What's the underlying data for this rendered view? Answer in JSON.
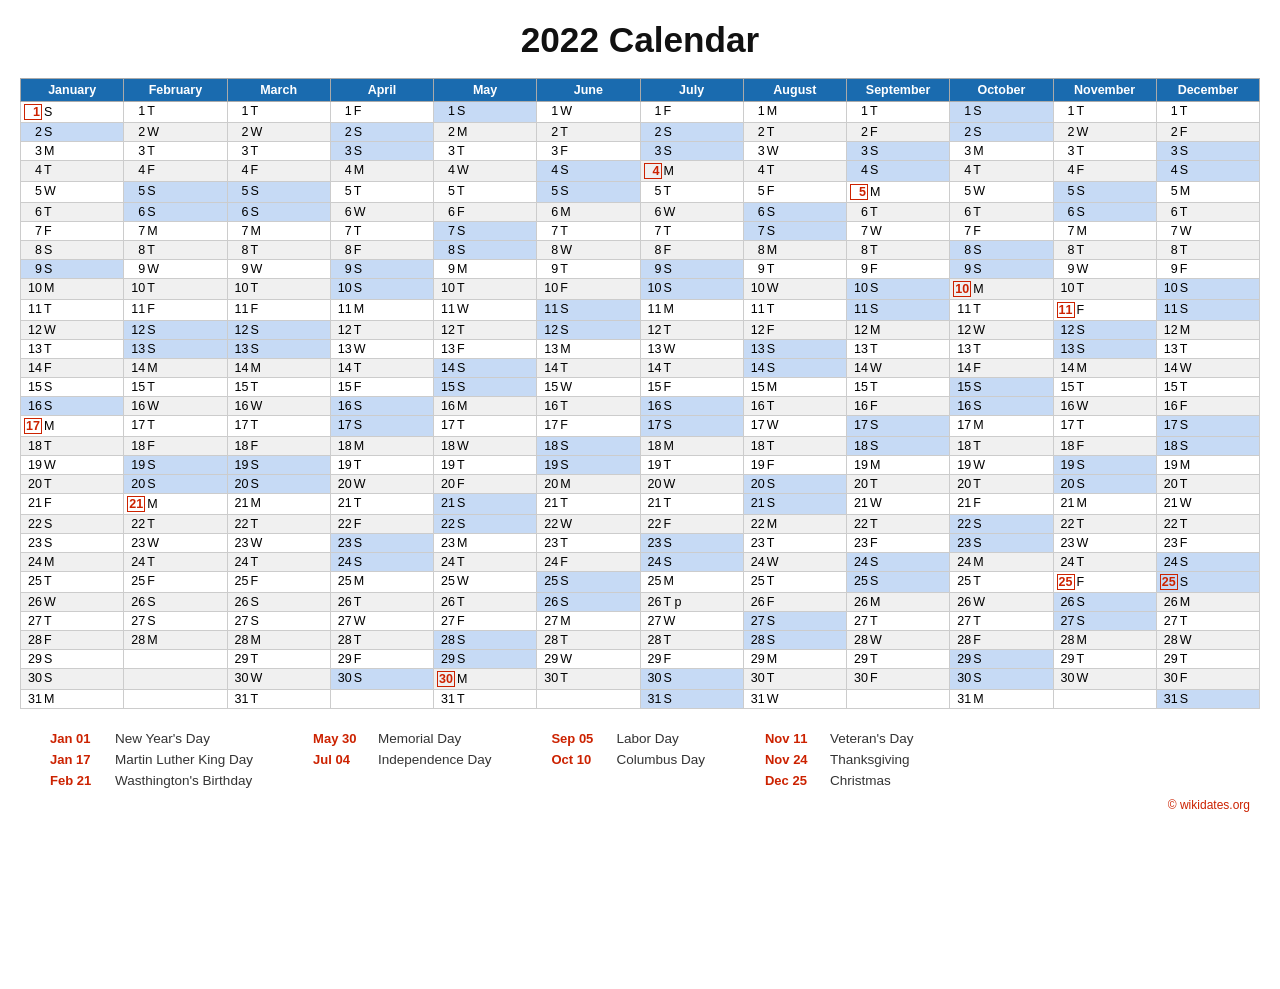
{
  "title": "2022 Calendar",
  "months": [
    "January",
    "February",
    "March",
    "April",
    "May",
    "June",
    "July",
    "August",
    "September",
    "October",
    "November",
    "December"
  ],
  "calendar": {
    "January": [
      "1 S",
      "2 S",
      "3 M",
      "4 T",
      "5 W",
      "6 T",
      "7 F",
      "8 S",
      "9 S",
      "10 M",
      "11 T",
      "12 W",
      "13 T",
      "14 F",
      "15 S",
      "16 S",
      "17 M",
      "18 T",
      "19 W",
      "20 T",
      "21 F",
      "22 S",
      "23 S",
      "24 M",
      "25 T",
      "26 W",
      "27 T",
      "28 F",
      "29 S",
      "30 S",
      "31 M"
    ],
    "February": [
      "1 T",
      "2 W",
      "3 T",
      "4 F",
      "5 S",
      "6 S",
      "7 M",
      "8 T",
      "9 W",
      "10 T",
      "11 F",
      "12 S",
      "13 S",
      "14 M",
      "15 T",
      "16 W",
      "17 T",
      "18 F",
      "19 S",
      "20 S",
      "21 M",
      "22 T",
      "23 W",
      "24 T",
      "25 F",
      "26 S",
      "27 S",
      "28 M",
      "",
      "",
      ""
    ],
    "March": [
      "1 T",
      "2 W",
      "3 T",
      "4 F",
      "5 S",
      "6 S",
      "7 M",
      "8 T",
      "9 W",
      "10 T",
      "11 F",
      "12 S",
      "13 S",
      "14 M",
      "15 T",
      "16 W",
      "17 T",
      "18 F",
      "19 S",
      "20 S",
      "21 M",
      "22 T",
      "23 W",
      "24 T",
      "25 F",
      "26 S",
      "27 S",
      "28 M",
      "29 T",
      "30 W",
      "31 T"
    ],
    "April": [
      "1 F",
      "2 S",
      "3 S",
      "4 M",
      "5 T",
      "6 W",
      "7 T",
      "8 F",
      "9 S",
      "10 S",
      "11 M",
      "12 T",
      "13 W",
      "14 T",
      "15 F",
      "16 S",
      "17 S",
      "18 M",
      "19 T",
      "20 W",
      "21 T",
      "22 F",
      "23 S",
      "24 S",
      "25 M",
      "26 T",
      "27 W",
      "28 T",
      "29 F",
      "30 S",
      ""
    ],
    "May": [
      "1 S",
      "2 M",
      "3 T",
      "4 W",
      "5 T",
      "6 F",
      "7 S",
      "8 S",
      "9 M",
      "10 T",
      "11 W",
      "12 T",
      "13 F",
      "14 S",
      "15 S",
      "16 M",
      "17 T",
      "18 W",
      "19 T",
      "20 F",
      "21 S",
      "22 S",
      "23 M",
      "24 T",
      "25 W",
      "26 T",
      "27 F",
      "28 S",
      "29 S",
      "30 M",
      "31 T"
    ],
    "June": [
      "1 W",
      "2 T",
      "3 F",
      "4 S",
      "5 S",
      "6 M",
      "7 T",
      "8 W",
      "9 T",
      "10 F",
      "11 S",
      "12 S",
      "13 M",
      "14 T",
      "15 W",
      "16 T",
      "17 F",
      "18 S",
      "19 S",
      "20 M",
      "21 T",
      "22 W",
      "23 T",
      "24 F",
      "25 S",
      "26 S",
      "27 M",
      "28 T",
      "29 W",
      "30 T",
      ""
    ],
    "July": [
      "1 F",
      "2 S",
      "3 S",
      "4 M",
      "5 T",
      "6 W",
      "7 T",
      "8 F",
      "9 S",
      "10 S",
      "11 M",
      "12 T",
      "13 W",
      "14 T",
      "15 F",
      "16 S",
      "17 S",
      "18 M",
      "19 T",
      "20 W",
      "21 T",
      "22 F",
      "23 S",
      "24 S",
      "25 M",
      "26 T p",
      "27 W",
      "28 T",
      "29 F",
      "30 S",
      "31 S"
    ],
    "August": [
      "1 M",
      "2 T",
      "3 W",
      "4 T",
      "5 F",
      "6 S",
      "7 S",
      "8 M",
      "9 T",
      "10 W",
      "11 T",
      "12 F",
      "13 S",
      "14 S",
      "15 M",
      "16 T",
      "17 W",
      "18 T",
      "19 F",
      "20 S",
      "21 S",
      "22 M",
      "23 T",
      "24 W",
      "25 T",
      "26 F",
      "27 S",
      "28 S",
      "29 M",
      "30 T",
      "31 W"
    ],
    "September": [
      "1 T",
      "2 F",
      "3 S",
      "4 S",
      "5 M",
      "6 T",
      "7 W",
      "8 T",
      "9 F",
      "10 S",
      "11 S",
      "12 M",
      "13 T",
      "14 W",
      "15 T",
      "16 F",
      "17 S",
      "18 S",
      "19 M",
      "20 T",
      "21 W",
      "22 T",
      "23 F",
      "24 S",
      "25 S",
      "26 M",
      "27 T",
      "28 W",
      "29 T",
      "30 F",
      ""
    ],
    "October": [
      "1 S",
      "2 S",
      "3 M",
      "4 T",
      "5 W",
      "6 T",
      "7 F",
      "8 S",
      "9 S",
      "10 M",
      "11 T",
      "12 W",
      "13 T",
      "14 F",
      "15 S",
      "16 S",
      "17 M",
      "18 T",
      "19 W",
      "20 T",
      "21 F",
      "22 S",
      "23 S",
      "24 M",
      "25 T",
      "26 W",
      "27 T",
      "28 F",
      "29 S",
      "30 S",
      "31 M"
    ],
    "November": [
      "1 T",
      "2 W",
      "3 T",
      "4 F",
      "5 S",
      "6 S",
      "7 M",
      "8 T",
      "9 W",
      "10 T",
      "11 F",
      "12 S",
      "13 S",
      "14 M",
      "15 T",
      "16 W",
      "17 T",
      "18 F",
      "19 S",
      "20 S",
      "21 M",
      "22 T",
      "23 W",
      "24 T",
      "25 F",
      "26 S",
      "27 S",
      "28 M",
      "29 T",
      "30 W",
      ""
    ],
    "December": [
      "1 T",
      "2 F",
      "3 S",
      "4 S",
      "5 M",
      "6 T",
      "7 W",
      "8 T",
      "9 F",
      "10 S",
      "11 S",
      "12 M",
      "13 T",
      "14 W",
      "15 T",
      "16 F",
      "17 S",
      "18 S",
      "19 M",
      "20 T",
      "21 W",
      "22 T",
      "23 F",
      "24 S",
      "25 S",
      "26 M",
      "27 T",
      "28 W",
      "29 T",
      "30 F",
      "31 S"
    ]
  },
  "special": {
    "red": {
      "January-1": "1",
      "January-17": "17",
      "February-21": "21",
      "July-4": "4",
      "October-10": "10",
      "November-11": "11",
      "November-25": "25",
      "December-25": "25",
      "May-30": "30",
      "September-5": "5"
    },
    "boxed": {
      "January-1": "1",
      "January-17": "17",
      "February-21": "21",
      "July-4": "4",
      "October-10": "10",
      "November-11": "11",
      "November-25": "25",
      "December-25": "25",
      "May-30": "30",
      "September-5": "5"
    }
  },
  "holidays": [
    {
      "date": "Jan 01",
      "name": "New Year's Day"
    },
    {
      "date": "Jan 17",
      "name": "Martin Luther King Day"
    },
    {
      "date": "Feb 21",
      "name": "Wasthington's Birthday"
    },
    {
      "date": "May 30",
      "name": "Memorial Day"
    },
    {
      "date": "Jul 04",
      "name": "Independence Day"
    },
    {
      "date": "Sep 05",
      "name": "Labor Day"
    },
    {
      "date": "Oct 10",
      "name": "Columbus Day"
    },
    {
      "date": "Nov 11",
      "name": "Veteran's Day"
    },
    {
      "date": "Nov 24",
      "name": "Thanksgiving"
    },
    {
      "date": "Dec 25",
      "name": "Christmas"
    }
  ],
  "footer": "© wikidates.org"
}
